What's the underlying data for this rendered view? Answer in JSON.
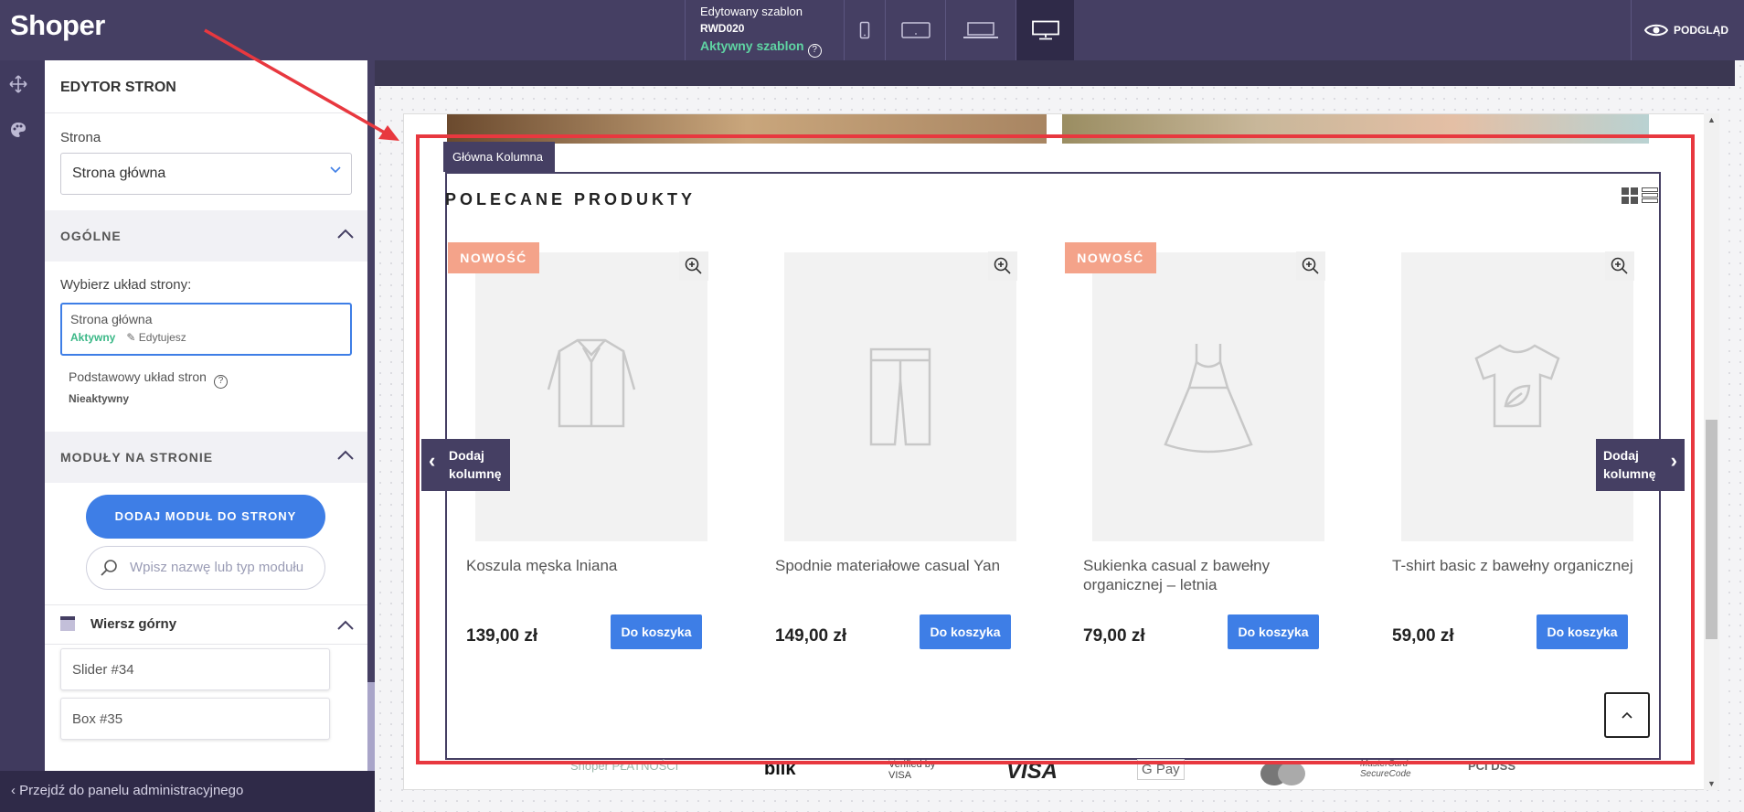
{
  "topbar": {
    "logo": "Shoper",
    "template_label": "Edytowany szablon",
    "template_code": "RWD020",
    "template_status": "Aktywny szablon",
    "preview_label": "PODGLĄD",
    "devices": [
      "mobile-icon",
      "tablet-icon",
      "laptop-icon",
      "desktop-icon"
    ],
    "active_device": "desktop-icon"
  },
  "panel": {
    "title": "EDYTOR STRON",
    "page_label": "Strona",
    "page_value": "Strona główna",
    "general_section": "OGÓLNE",
    "layout_label": "Wybierz układ strony:",
    "layouts": [
      {
        "name": "Strona główna",
        "status": "Aktywny",
        "edit": "Edytujesz"
      },
      {
        "name": "Podstawowy układ stron",
        "status": "Nieaktywny"
      }
    ],
    "modules_section": "MODUŁY NA STRONIE",
    "add_module_label": "DODAJ MODUŁ DO STRONY",
    "search_placeholder": "Wpisz nazwę lub typ modułu",
    "row_label": "Wiersz górny",
    "modules": [
      "Slider #34",
      "Box #35"
    ],
    "back_link": "Przejdź do panelu administracyjnego"
  },
  "canvas": {
    "column_tag": "Główna Kolumna",
    "section_title": "POLECANE PRODUKTY",
    "badge": "NOWOŚĆ",
    "add_column": "Dodaj kolumnę",
    "cart_label": "Do koszyka",
    "products": [
      {
        "name": "Koszula męska lniana",
        "price": "139,00 zł",
        "badge": true,
        "icon": "shirt-icon"
      },
      {
        "name": "Spodnie materiałowe casual Yan",
        "price": "149,00 zł",
        "badge": false,
        "icon": "pants-icon"
      },
      {
        "name": "Sukienka casual z bawełny organicznej – letnia",
        "price": "79,00 zł",
        "badge": true,
        "icon": "dress-icon"
      },
      {
        "name": "T-shirt basic z bawełny organicznej",
        "price": "59,00 zł",
        "badge": false,
        "icon": "tshirt-icon"
      }
    ],
    "payments": [
      "Shoper PŁATNOŚCI",
      "blik",
      "Verified by VISA",
      "VISA",
      "G Pay",
      "MasterCard SecureCode",
      "PCI DSS"
    ]
  },
  "colors": {
    "brand": "#453f63",
    "accent": "#3e7ee6",
    "active_status": "#5fd4a3",
    "badge": "#f4a38a",
    "highlight": "#e8383f"
  }
}
